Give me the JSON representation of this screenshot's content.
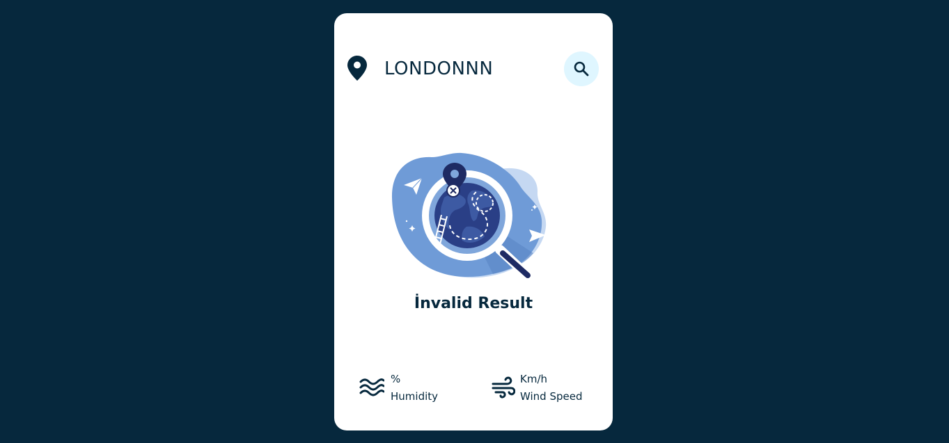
{
  "search": {
    "value": "LONDONNN",
    "icon": "search-icon",
    "button_color": "#DFF6FF"
  },
  "location_icon": "map-pin-icon",
  "illustration": "not-found-globe-illustration",
  "result": {
    "message": "İnvalid Result"
  },
  "details": {
    "humidity": {
      "value": "%",
      "label": "Humidity",
      "icon": "water-waves-icon"
    },
    "wind": {
      "value": "Km/h",
      "label": "Wind Speed",
      "icon": "wind-icon"
    }
  },
  "colors": {
    "background": "#06283D",
    "card": "#FFFFFF",
    "text": "#06283D",
    "accent": "#DFF6FF"
  }
}
